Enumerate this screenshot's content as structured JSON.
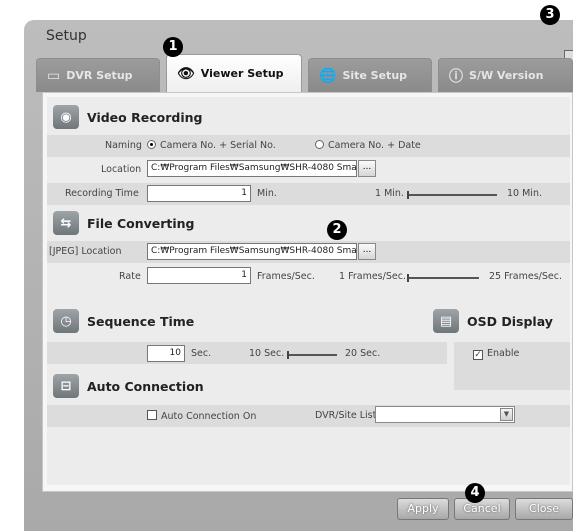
{
  "window": {
    "title": "Setup"
  },
  "tabs": [
    {
      "label": "DVR Setup",
      "icon": "dvr-icon"
    },
    {
      "label": "Viewer Setup",
      "icon": "viewer-eye-wrench-icon"
    },
    {
      "label": "Site Setup",
      "icon": "globe-wrench-icon"
    },
    {
      "label": "S/W Version",
      "icon": "info-icon"
    }
  ],
  "callouts": [
    "1",
    "2",
    "3",
    "4"
  ],
  "video_recording": {
    "title": "Video Recording",
    "naming_label": "Naming",
    "naming_options": [
      "Camera No. + Serial No.",
      "Camera No. + Date"
    ],
    "naming_selected": "Camera No. + Serial No.",
    "location_label": "Location",
    "location_value": "C:₩Program Files₩Samsung₩SHR-4080 Sma",
    "browse_label": "...",
    "recording_time_label": "Recording Time",
    "recording_time_value": "1",
    "recording_time_unit": "Min.",
    "slider_min": "1 Min.",
    "slider_max": "10 Min."
  },
  "file_converting": {
    "title": "File Converting",
    "location_label": "[JPEG]  Location",
    "location_value": "C:₩Program Files₩Samsung₩SHR-4080 Sma",
    "browse_label": "...",
    "rate_label": "Rate",
    "rate_value": "1",
    "rate_unit": "Frames/Sec.",
    "slider_min": "1 Frames/Sec.",
    "slider_max": "25 Frames/Sec."
  },
  "sequence_time": {
    "title": "Sequence Time",
    "value": "10",
    "unit": "Sec.",
    "slider_min": "10 Sec.",
    "slider_max": "20 Sec."
  },
  "osd_display": {
    "title": "OSD Display",
    "enable_label": "Enable",
    "enabled": true
  },
  "auto_connection": {
    "title": "Auto Connection",
    "checkbox_label": "Auto Connection On",
    "checked": false,
    "dvr_site_list_label": "DVR/Site List",
    "dvr_site_list_value": ""
  },
  "buttons": {
    "apply": "Apply",
    "cancel": "Cancel",
    "close": "Close"
  }
}
